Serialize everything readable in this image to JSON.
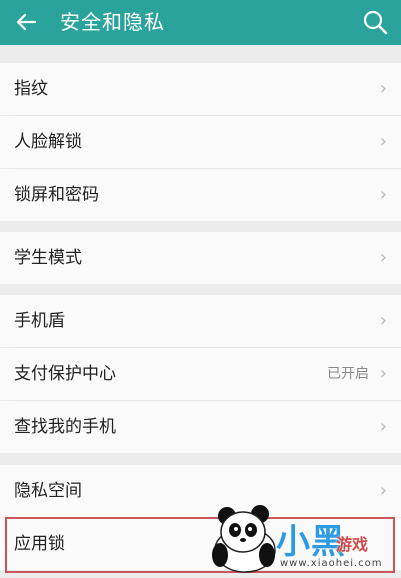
{
  "header": {
    "back_icon": "arrow-left-icon",
    "title": "安全和隐私",
    "search_icon": "search-icon"
  },
  "groups": [
    {
      "items": [
        {
          "label": "指纹"
        },
        {
          "label": "人脸解锁"
        },
        {
          "label": "锁屏和密码"
        }
      ]
    },
    {
      "items": [
        {
          "label": "学生模式"
        }
      ]
    },
    {
      "items": [
        {
          "label": "手机盾"
        },
        {
          "label": "支付保护中心",
          "value": "已开启"
        },
        {
          "label": "查找我的手机"
        }
      ]
    },
    {
      "items": [
        {
          "label": "隐私空间"
        },
        {
          "label": "应用锁"
        }
      ]
    }
  ],
  "chevron": "›",
  "colors": {
    "header_bg": "#2aa39c",
    "highlight_border": "#c9545a"
  },
  "watermark": {
    "logo_text": "小黑",
    "sub_text": "游戏",
    "url": "www.xiaohei.com"
  }
}
